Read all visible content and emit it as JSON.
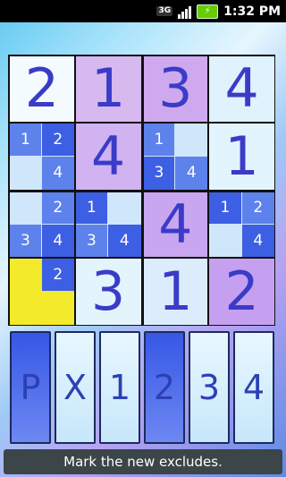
{
  "status_bar": {
    "network": "3G",
    "time": "1:32 PM"
  },
  "board": {
    "size": 4,
    "cells": [
      {
        "row": 0,
        "col": 0,
        "value": "2",
        "notes": [],
        "color": "#f4fbff"
      },
      {
        "row": 0,
        "col": 1,
        "value": "1",
        "notes": [],
        "color": "#d7b9f0"
      },
      {
        "row": 0,
        "col": 2,
        "value": "3",
        "notes": [],
        "color": "#cfa9ef"
      },
      {
        "row": 0,
        "col": 3,
        "value": "4",
        "notes": [],
        "color": "#dff2fd"
      },
      {
        "row": 1,
        "col": 0,
        "value": "",
        "notes": [
          "1",
          "2",
          "",
          "4"
        ],
        "color": "#cfe6fb"
      },
      {
        "row": 1,
        "col": 1,
        "value": "4",
        "notes": [],
        "color": "#d2b3f1"
      },
      {
        "row": 1,
        "col": 2,
        "value": "",
        "notes": [
          "1",
          "",
          "3",
          "4"
        ],
        "color": "#cfe6fb"
      },
      {
        "row": 1,
        "col": 3,
        "value": "1",
        "notes": [],
        "color": "#e2f4fe"
      },
      {
        "row": 2,
        "col": 0,
        "value": "",
        "notes": [
          "",
          "2",
          "3",
          "4"
        ],
        "color": "#cfe6fb"
      },
      {
        "row": 2,
        "col": 1,
        "value": "",
        "notes": [
          "1",
          "",
          "3",
          "4"
        ],
        "color": "#cfe6fb"
      },
      {
        "row": 2,
        "col": 2,
        "value": "4",
        "notes": [],
        "color": "#c9a6f0"
      },
      {
        "row": 2,
        "col": 3,
        "value": "",
        "notes": [
          "1",
          "2",
          "",
          "4"
        ],
        "color": "#cfe6fb"
      },
      {
        "row": 3,
        "col": 0,
        "value": "",
        "notes": [
          "",
          "2",
          "",
          ""
        ],
        "color": "#f2ea2a"
      },
      {
        "row": 3,
        "col": 1,
        "value": "3",
        "notes": [],
        "color": "#e3f4fd"
      },
      {
        "row": 3,
        "col": 2,
        "value": "1",
        "notes": [],
        "color": "#dcecfd"
      },
      {
        "row": 3,
        "col": 3,
        "value": "2",
        "notes": [],
        "color": "#c6a0f0"
      }
    ]
  },
  "controls": [
    {
      "label": "P",
      "selected": true
    },
    {
      "label": "X",
      "selected": false
    },
    {
      "label": "1",
      "selected": false
    },
    {
      "label": "2",
      "selected": true
    },
    {
      "label": "3",
      "selected": false
    },
    {
      "label": "4",
      "selected": false
    }
  ],
  "hint": "Mark the new excludes."
}
